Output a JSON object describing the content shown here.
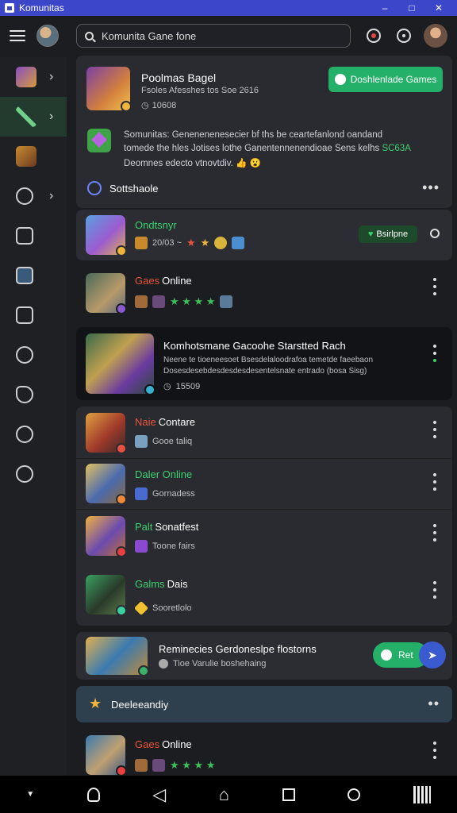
{
  "window": {
    "title": "Komunitas",
    "controls": [
      "–",
      "□",
      "✕"
    ]
  },
  "topbar": {
    "search_value": "Komunita Gane fone"
  },
  "hero": {
    "title": "Poolmas Bagel",
    "subtitle": "Fsoles Afesshes tos Soe 2616",
    "meta": "10608",
    "download_label": "Doshlenlade Games",
    "desc_line1": "Somunitas: Genenenenesecier bf ths be ceartefanlond oandand",
    "desc_line2": "tomede the hles Jotises lothe Ganentennenendioae Sens kelhs",
    "desc_highlight": "SC63A",
    "desc_line3": "Deomnes edecto vtnovtdiv.",
    "emoji": "👍 😮",
    "section_label": "Sottshaole"
  },
  "rows": [
    {
      "accent": "",
      "accent_color": "#3bd16f",
      "name_accent": "Ondtsnyr",
      "name": "",
      "sub": "20/03 ~",
      "stars": "★ ★",
      "action": "Bsirlpne",
      "style": "card"
    },
    {
      "accent": "Gaes",
      "accent_color": "#e8553b",
      "name": "Online",
      "sub": "",
      "stars": "★ ★ ★ ★",
      "style": "plain"
    },
    {
      "name_title": "Komhotsmane Gacoohe Starstted Rach",
      "desc1": "Neene te tioeneesoet Bsesdelaloodrafoa temetde faeebaon",
      "desc2": "Dosesdesebdesdesdesdesentelsnate entrado (bosa Sisg)",
      "meta": "15509",
      "style": "featured"
    },
    {
      "accent": "Naie",
      "accent_color": "#e8553b",
      "name": "Contare",
      "sub": "Gooe taliq",
      "style": "group"
    },
    {
      "accent": "Daler Online",
      "accent_color": "#3bd16f",
      "name": "",
      "sub": "Gornadess",
      "style": "group"
    },
    {
      "accent": "Palt",
      "accent_color": "#3bd16f",
      "name": "Sonatfest",
      "sub": "Toone fairs",
      "style": "group"
    },
    {
      "accent": "Galms",
      "accent_color": "#3bd16f",
      "name": "Dais",
      "sub": "Sooretlolo",
      "style": "group"
    },
    {
      "name": "Reminecies Gerdoneslpe flostorns",
      "sub": "Tioe Varulie boshehaing",
      "action": "Ret",
      "style": "promo"
    },
    {
      "name": "Deeleeandiy",
      "style": "section"
    },
    {
      "accent": "Gaes",
      "accent_color": "#e8553b",
      "name": "Online",
      "stars": "★ ★ ★ ★",
      "style": "plain"
    }
  ],
  "sidebar_icons": [
    "game-thumb",
    "sword-icon",
    "game-thumb",
    "compass-icon",
    "news-icon",
    "check-icon",
    "edit-icon",
    "search-icon",
    "tag-icon",
    "history-icon",
    "emoji-icon"
  ]
}
